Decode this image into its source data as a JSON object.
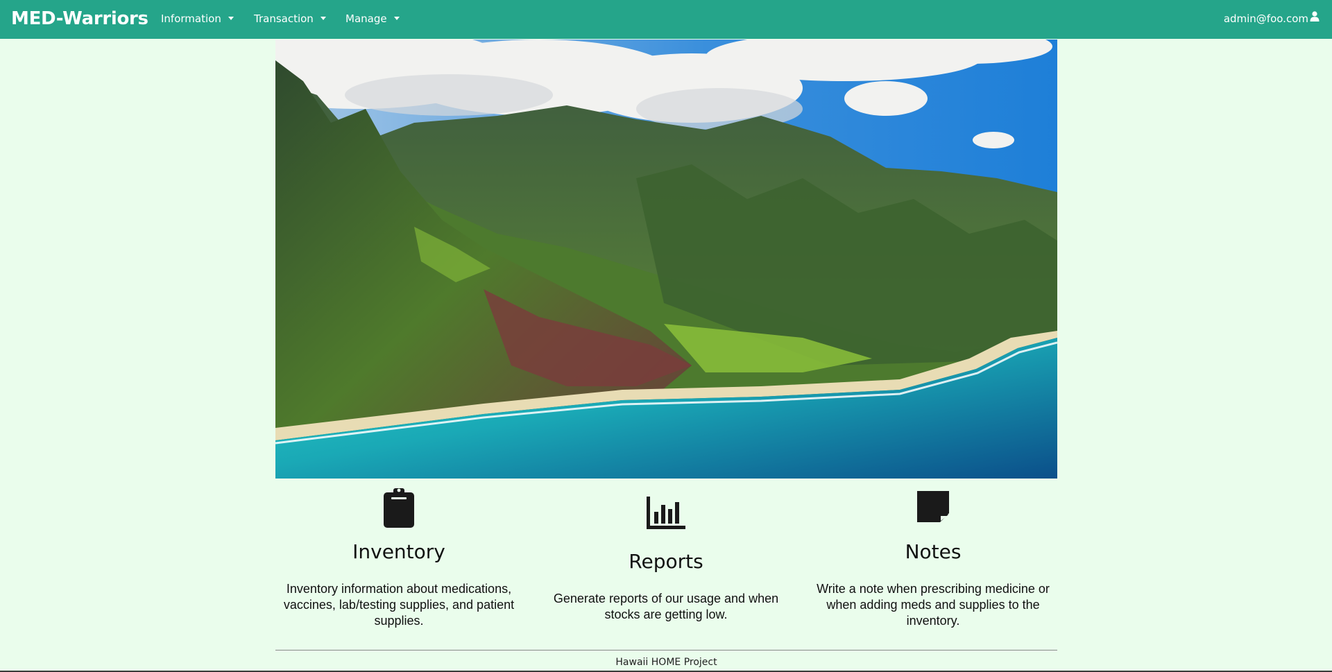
{
  "navbar": {
    "brand": "MED-Warriors",
    "menus": [
      {
        "label": "Information"
      },
      {
        "label": "Transaction"
      },
      {
        "label": "Manage"
      }
    ],
    "user": {
      "email": "admin@foo.com",
      "icon": "user-icon"
    },
    "background_color": "#25a58a"
  },
  "hero": {
    "image": "aerial view of green mountain cliffs above a turquoise ocean coastline"
  },
  "features": [
    {
      "icon": "clipboard-icon",
      "title": "Inventory",
      "description": "Inventory information about medications, vaccines, lab/testing supplies, and patient supplies."
    },
    {
      "icon": "bar-chart-icon",
      "title": "Reports",
      "description": "Generate reports of our usage and when stocks are getting low."
    },
    {
      "icon": "sticky-note-icon",
      "title": "Notes",
      "description": "Write a note when prescribing medicine or when adding meds and supplies to the inventory."
    }
  ],
  "footer": {
    "text": "Hawaii HOME Project"
  },
  "colors": {
    "page_background": "#eafdec",
    "accent": "#25a58a"
  }
}
